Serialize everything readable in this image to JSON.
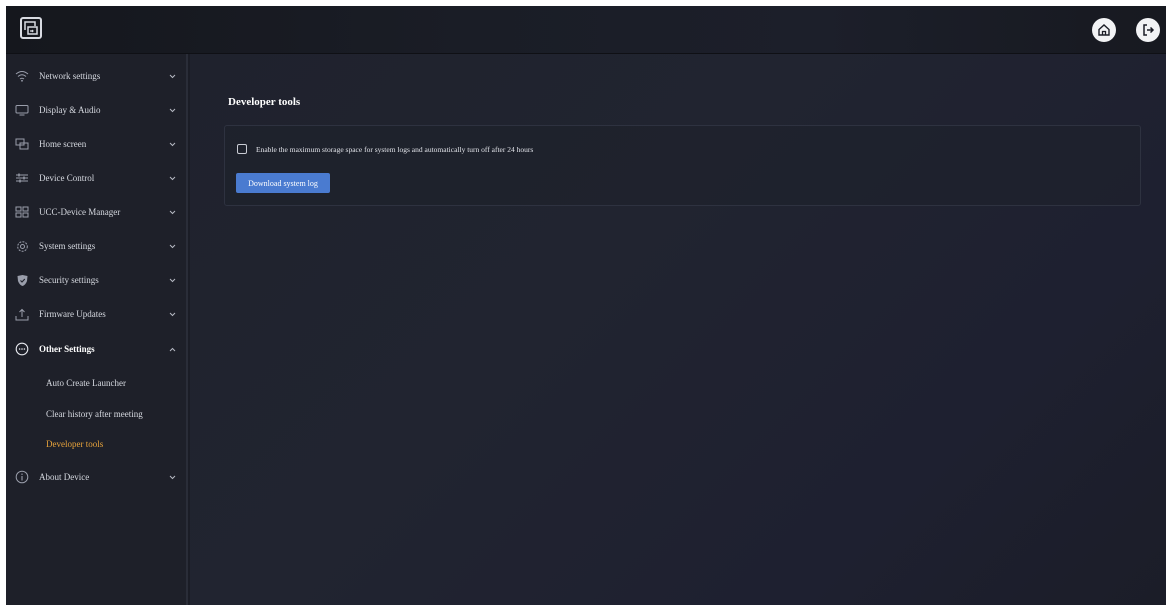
{
  "sidebar": {
    "items": [
      {
        "label": "Network settings",
        "icon": "wifi-icon",
        "expanded": false
      },
      {
        "label": "Display & Audio",
        "icon": "monitor-icon",
        "expanded": false
      },
      {
        "label": "Home screen",
        "icon": "home-screen-icon",
        "expanded": false
      },
      {
        "label": "Device Control",
        "icon": "sliders-icon",
        "expanded": false
      },
      {
        "label": "UCC-Device Manager",
        "icon": "device-manager-icon",
        "expanded": false
      },
      {
        "label": "System settings",
        "icon": "gear-icon",
        "expanded": false
      },
      {
        "label": "Security settings",
        "icon": "shield-icon",
        "expanded": false
      },
      {
        "label": "Firmware Updates",
        "icon": "upload-icon",
        "expanded": false
      },
      {
        "label": "Other Settings",
        "icon": "more-icon",
        "expanded": true
      },
      {
        "label": "About Device",
        "icon": "info-icon",
        "expanded": false
      }
    ],
    "sub_items": [
      {
        "label": "Auto Create Launcher",
        "active": false
      },
      {
        "label": "Clear history after meeting",
        "active": false
      },
      {
        "label": "Developer tools",
        "active": true
      }
    ]
  },
  "main": {
    "title": "Developer tools",
    "checkbox_label": "Enable the maximum storage space for system logs and automatically turn off after 24 hours",
    "checkbox_checked": false,
    "download_button": "Download system log"
  },
  "colors": {
    "accent": "#4a7bd0",
    "active_text": "#e8a33b",
    "background": "#1b1d26"
  }
}
